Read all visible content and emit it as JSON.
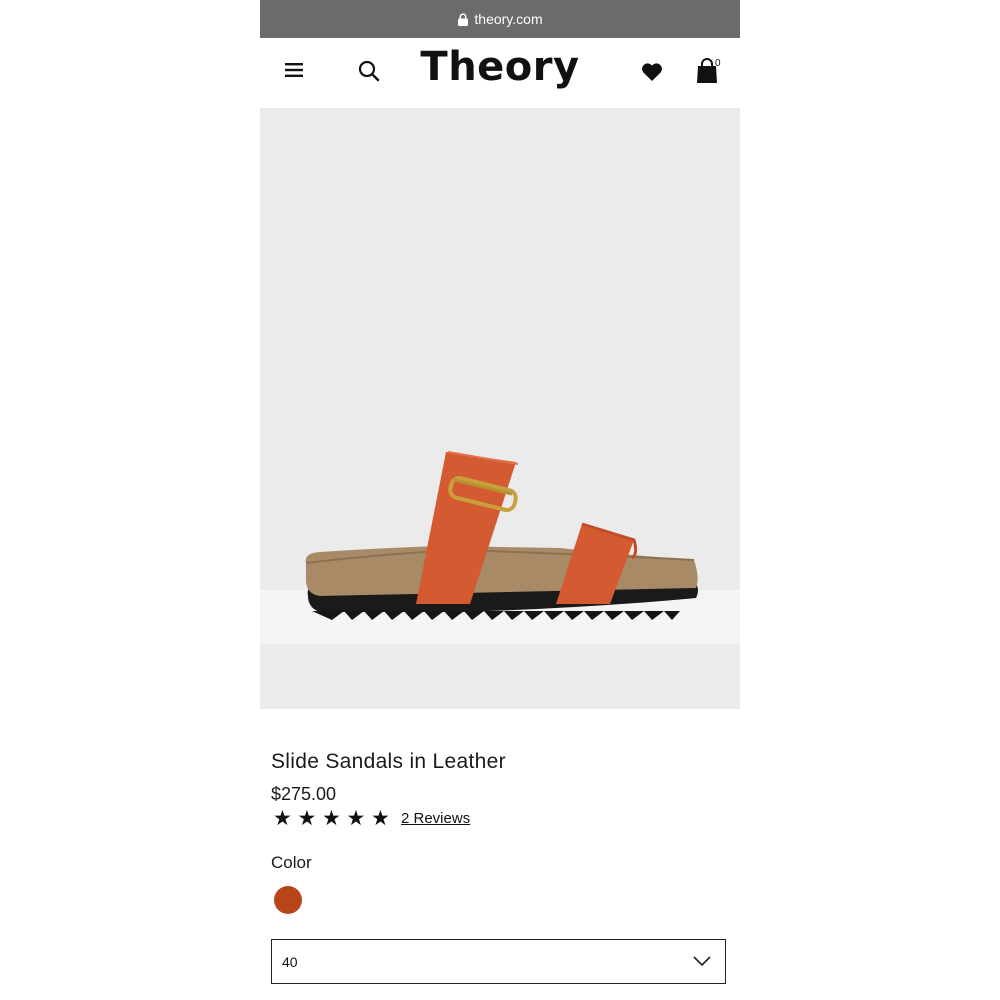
{
  "browser": {
    "url": "theory.com"
  },
  "header": {
    "logo": "Theory",
    "cart_count": "0"
  },
  "product": {
    "title": "Slide Sandals in Leather",
    "price": "$275.00",
    "rating": 5,
    "rating_max": 5,
    "reviews_label": "2 Reviews",
    "color_label": "Color",
    "selected_color": "#b8461a",
    "size_value": "40"
  },
  "icons": {
    "menu": "menu-icon",
    "search": "search-icon",
    "wishlist": "heart-icon",
    "cart": "shopping-bag-icon",
    "lock": "lock-icon",
    "dropdown": "chevron-down-icon"
  },
  "colors": {
    "url_bar": "#6b6b6b",
    "image_bg": "#ebebec",
    "strap": "#d45a32",
    "footbed": "#a88a66"
  }
}
